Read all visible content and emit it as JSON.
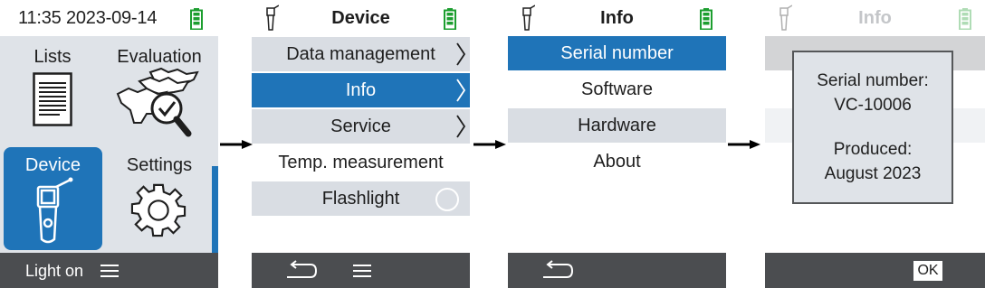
{
  "colors": {
    "accent": "#1f74b8",
    "row_gray": "#d9dde3",
    "panel_gray": "#dfe3e8",
    "bar_dark": "#4b4d50",
    "battery_green": "#1c9e2f"
  },
  "screen1": {
    "time": "11:35",
    "date": "2023-09-14",
    "tiles": [
      {
        "label": "Lists",
        "icon": "document-list-icon"
      },
      {
        "label": "Evaluation",
        "icon": "cows-check-icon"
      },
      {
        "label": "Device",
        "icon": "device-reader-icon",
        "selected": true
      },
      {
        "label": "Settings",
        "icon": "gear-icon"
      }
    ],
    "bottom_left": "Light on",
    "menu_icon": "hamburger-icon"
  },
  "screen2": {
    "title": "Device",
    "items": [
      {
        "label": "Data management",
        "has_submenu": true
      },
      {
        "label": "Info",
        "has_submenu": true,
        "selected": true
      },
      {
        "label": "Service",
        "has_submenu": true
      },
      {
        "label": "Temp. measurement"
      },
      {
        "label": "Flashlight",
        "toggle": "off"
      }
    ]
  },
  "screen3": {
    "title": "Info",
    "items": [
      {
        "label": "Serial number",
        "selected": true
      },
      {
        "label": "Software"
      },
      {
        "label": "Hardware"
      },
      {
        "label": "About"
      }
    ]
  },
  "screen4": {
    "title": "Info",
    "dialog": {
      "serial_label": "Serial number:",
      "serial_value": "VC-10006",
      "produced_label": "Produced:",
      "produced_value": "August 2023"
    },
    "ok_label": "OK"
  }
}
